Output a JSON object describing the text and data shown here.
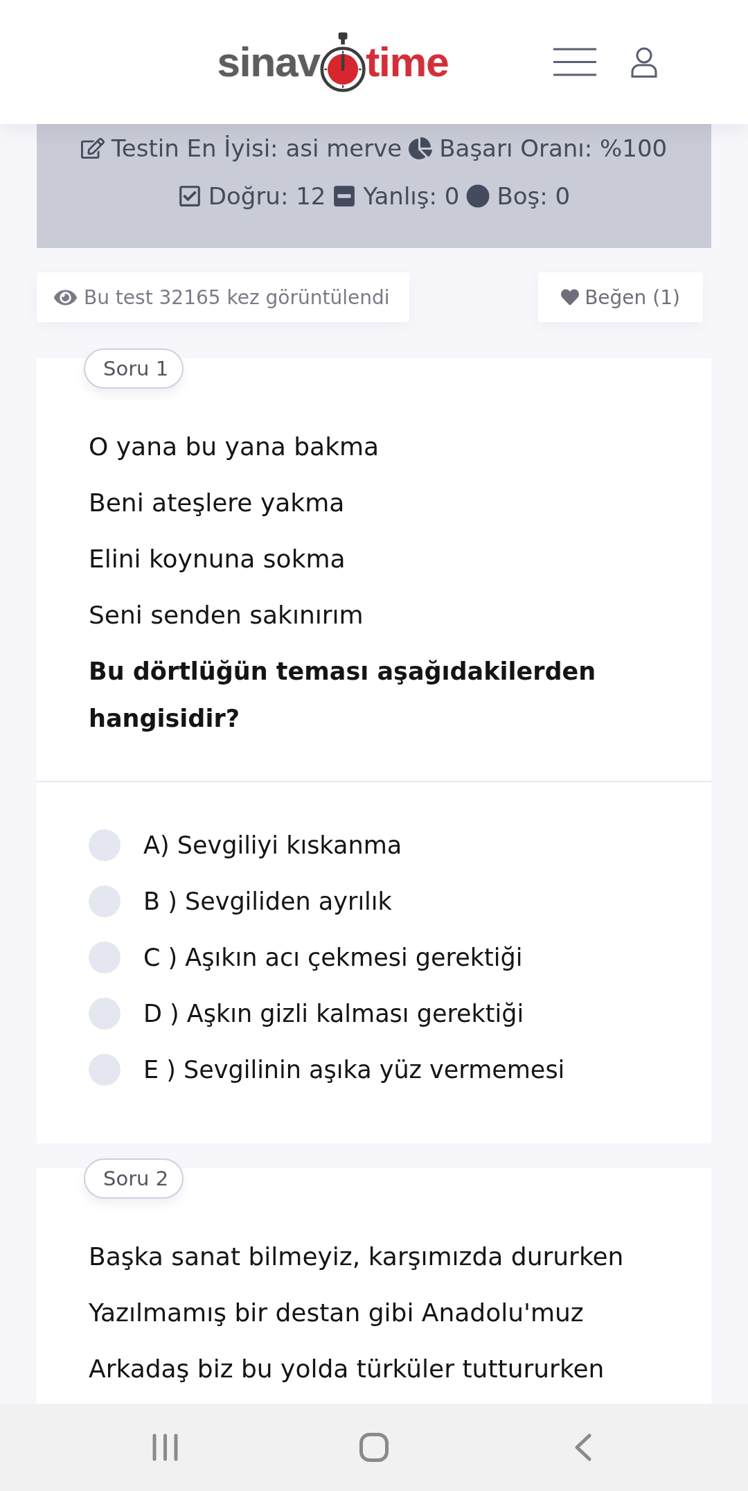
{
  "header": {
    "logo": {
      "left": "sinav",
      "right": "time"
    }
  },
  "stats": {
    "rows": [
      [
        {
          "kind": "edit",
          "text": "Testin En İyisi: asi merve"
        },
        {
          "kind": "pie",
          "text": "Başarı Oranı: %100"
        }
      ],
      [
        {
          "kind": "check",
          "text": "Doğru: 12"
        },
        {
          "kind": "minus",
          "text": "Yanlış: 0"
        },
        {
          "kind": "dot",
          "text": "Boş: 0"
        }
      ]
    ]
  },
  "views": {
    "text": "Bu test 32165 kez görüntülendi"
  },
  "like_button": {
    "label": "Beğen (1)"
  },
  "questions": [
    {
      "label": "Soru 1",
      "lines": [
        "O yana bu yana bakma",
        "Beni ateşlere yakma",
        "Elini koynuna sokma",
        "Seni senden sakınırım"
      ],
      "prompt": "Bu dörtlüğün teması aşağıdakilerden hangisidir?",
      "options": [
        {
          "text": "A) Sevgiliyi kıskanma",
          "selected": false
        },
        {
          "text": "B ) Sevgiliden ayrılık",
          "selected": false
        },
        {
          "text": "C ) Aşıkın acı çekmesi gerektiği",
          "selected": false
        },
        {
          "text": "D ) Aşkın gizli kalması gerektiği",
          "selected": false
        },
        {
          "text": "E ) Sevgilinin aşıka yüz vermemesi",
          "selected": false
        }
      ]
    },
    {
      "label": "Soru 2",
      "lines": [
        "Başka sanat bilmeyiz, karşımızda dururken",
        "Yazılmamış bir destan gibi Anadolu'muz",
        "Arkadaş biz bu yolda türküler tuttururken"
      ]
    }
  ]
}
